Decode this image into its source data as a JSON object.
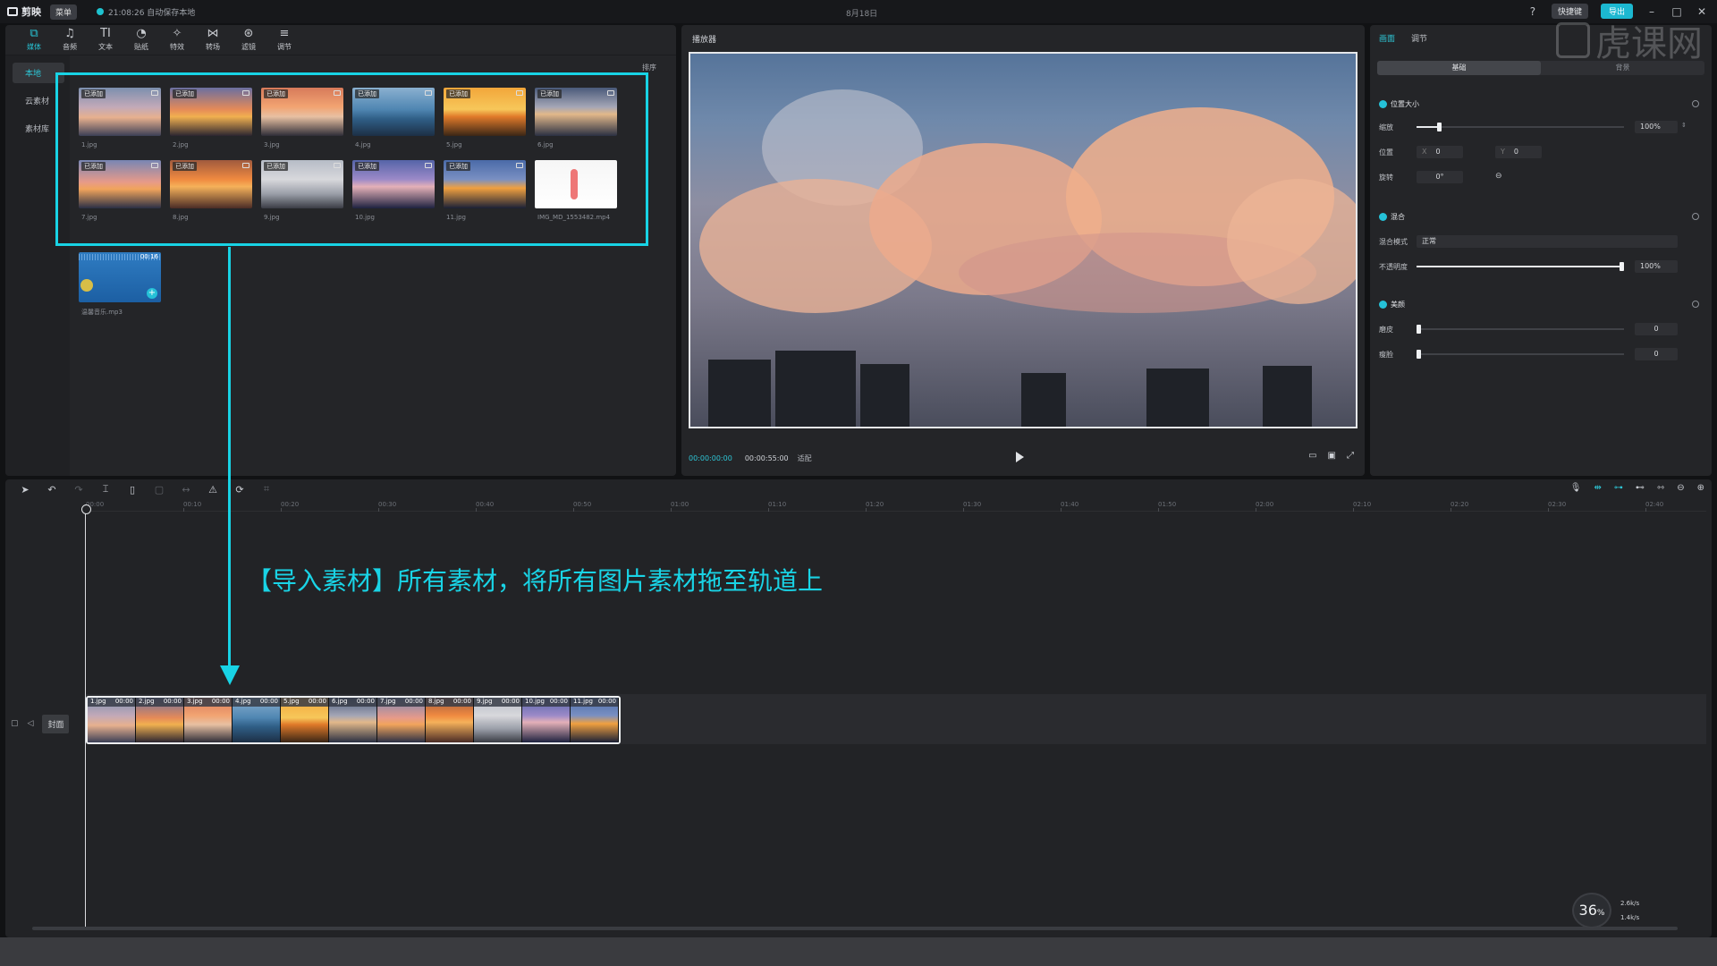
{
  "app": {
    "name": "剪映",
    "menu": "菜单",
    "save_status": "21:08:26 自动保存本地",
    "window_title": "8月18日",
    "shortcut": "快捷键",
    "export": "导出"
  },
  "watermark": "虎课网",
  "toolbar": [
    {
      "icon": "media-icon",
      "glyph": "⧉",
      "label": "媒体"
    },
    {
      "icon": "audio-icon",
      "glyph": "♫",
      "label": "音频"
    },
    {
      "icon": "text-icon",
      "glyph": "TI",
      "label": "文本"
    },
    {
      "icon": "sticker-icon",
      "glyph": "◔",
      "label": "贴纸"
    },
    {
      "icon": "effects-icon",
      "glyph": "✧",
      "label": "特效"
    },
    {
      "icon": "transition-icon",
      "glyph": "⋈",
      "label": "转场"
    },
    {
      "icon": "filter-icon",
      "glyph": "⊛",
      "label": "滤镜"
    },
    {
      "icon": "adjust-icon",
      "glyph": "≡",
      "label": "调节"
    }
  ],
  "media_side": [
    "本地",
    "云素材",
    "素材库"
  ],
  "media_sort": "排序",
  "media_items": [
    {
      "name": "1.jpg",
      "tag": "已添加",
      "bg": "linear-gradient(180deg,#7c8fae 0%,#c2a9b8 40%,#e7b08e 62%,#3b3f55 100%)"
    },
    {
      "name": "2.jpg",
      "tag": "已添加",
      "bg": "linear-gradient(180deg,#6a6fa0 0%,#e58a58 45%,#f1b050 60%,#2b2530 100%)"
    },
    {
      "name": "3.jpg",
      "tag": "已添加",
      "bg": "linear-gradient(180deg,#d77a5a 0%,#f2a472 40%,#e8c0a2 60%,#2e2d38 100%)"
    },
    {
      "name": "4.jpg",
      "tag": "已添加",
      "bg": "linear-gradient(180deg,#8ab0d0 0%,#4f86b2 45%,#2f5e86 65%,#1d2f45 100%)"
    },
    {
      "name": "5.jpg",
      "tag": "已添加",
      "bg": "linear-gradient(180deg,#f2a63a 0%,#f7c75a 45%,#e07a2a 60%,#3a2616 100%)"
    },
    {
      "name": "6.jpg",
      "tag": "已添加",
      "bg": "linear-gradient(180deg,#4a5a7a 0%,#a4a6b6 40%,#e2b88a 55%,#2a3042 100%)"
    },
    {
      "name": "7.jpg",
      "tag": "已添加",
      "bg": "linear-gradient(180deg,#7886b4 0%,#e69a8a 45%,#f1a45c 60%,#2a2f45 100%)"
    },
    {
      "name": "8.jpg",
      "tag": "已添加",
      "bg": "linear-gradient(180deg,#a05a3e 0%,#f08a40 40%,#f5b15a 55%,#4a2c26 100%)"
    },
    {
      "name": "9.jpg",
      "tag": "已添加",
      "bg": "linear-gradient(180deg,#b6bcc6 0%,#d8d8dc 40%,#9a9ea8 70%,#3a3c44 100%)"
    },
    {
      "name": "10.jpg",
      "tag": "已添加",
      "bg": "linear-gradient(180deg,#5564a8 0%,#9c8ac8 40%,#e4b0b8 55%,#1e2240 100%)"
    },
    {
      "name": "11.jpg",
      "tag": "已添加",
      "bg": "linear-gradient(180deg,#4a6aa8 0%,#7a90c2 40%,#f0a040 58%,#1a2036 100%)"
    },
    {
      "name": "IMG_MD_1553482.mp4",
      "tag": "",
      "bg": "linear-gradient(180deg,#f6f6f6 0%,#ffffff 100%)"
    }
  ],
  "audio_item": {
    "name": "温馨音乐.mp3",
    "duration": "00:16"
  },
  "player": {
    "title": "播放器",
    "time_current": "00:00:00:00",
    "time_total": "00:00:55:00",
    "ratio": "适配"
  },
  "props": {
    "tabs": [
      "画面",
      "调节"
    ],
    "seg": [
      "基础",
      "背景"
    ],
    "sections": {
      "position": "位置大小",
      "blend": "混合",
      "beauty": "美颜"
    },
    "scale_label": "缩放",
    "scale_value": "100%",
    "scale_level": 0.1,
    "pos_label": "位置",
    "pos_x": "0",
    "pos_y": "0",
    "x_label": "X",
    "y_label": "Y",
    "rotate_label": "旋转",
    "rotate_value": "0°",
    "blend_mode_label": "混合模式",
    "blend_mode": "正常",
    "opacity_label": "不透明度",
    "opacity_value": "100%",
    "opacity_level": 1.0,
    "smooth_label": "磨皮",
    "smooth_value": "0",
    "smooth_level": 0,
    "thin_label": "瘦脸",
    "thin_value": "0",
    "thin_level": 0
  },
  "timeline": {
    "ticks": [
      "00:00",
      "00:10",
      "00:20",
      "00:30",
      "00:40",
      "00:50",
      "01:00",
      "01:10",
      "01:20",
      "01:30",
      "01:40",
      "01:50",
      "02:00",
      "02:10",
      "02:20",
      "02:30",
      "02:40"
    ],
    "cover_label": "封面",
    "clips": [
      {
        "label": "1.jpg",
        "dur": "00:00"
      },
      {
        "label": "2.jpg",
        "dur": "00:00"
      },
      {
        "label": "3.jpg",
        "dur": "00:00"
      },
      {
        "label": "4.jpg",
        "dur": "00:00"
      },
      {
        "label": "5.jpg",
        "dur": "00:00"
      },
      {
        "label": "6.jpg",
        "dur": "00:00"
      },
      {
        "label": "7.jpg",
        "dur": "00:00"
      },
      {
        "label": "8.jpg",
        "dur": "00:00"
      },
      {
        "label": "9.jpg",
        "dur": "00:00"
      },
      {
        "label": "10.jpg",
        "dur": "00:00"
      },
      {
        "label": "11.jpg",
        "dur": "00:00"
      }
    ]
  },
  "annotation": "【导入素材】所有素材，将所有图片素材拖至轨道上",
  "speed": {
    "value": "36",
    "unit": "%",
    "up": "2.6k/s",
    "down": "1.4k/s"
  }
}
